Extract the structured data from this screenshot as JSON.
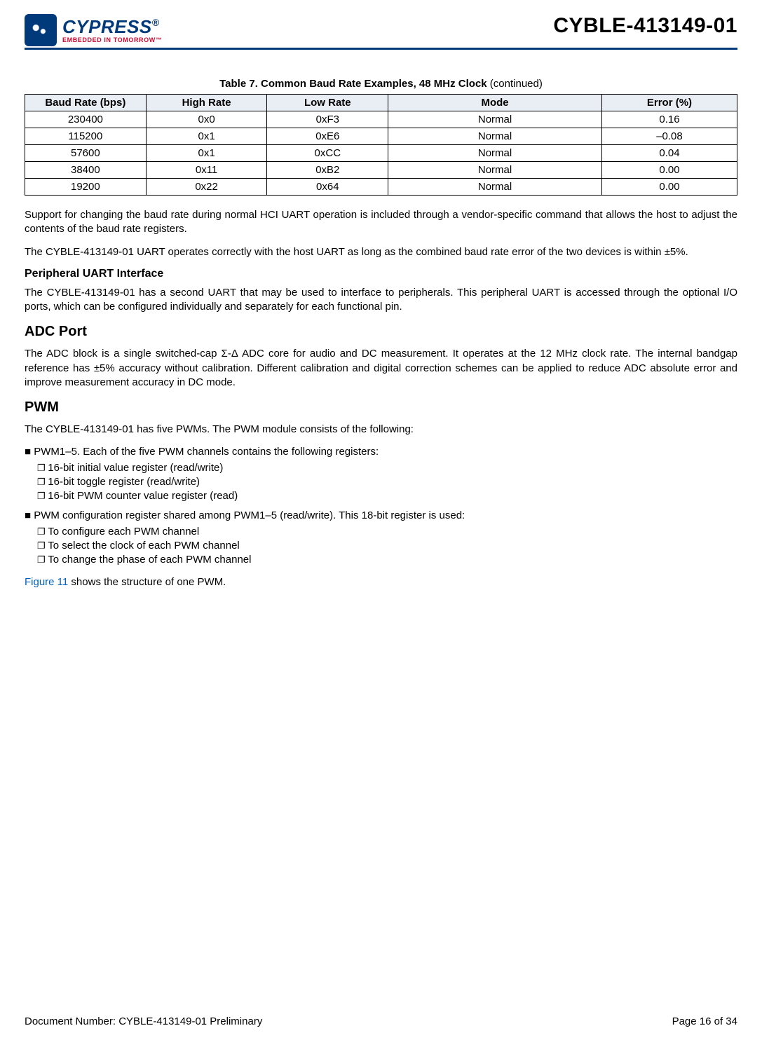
{
  "header": {
    "logo_name": "CYPRESS",
    "logo_reg": "®",
    "logo_tag": "EMBEDDED IN TOMORROW™",
    "doc_title": "CYBLE-413149-01"
  },
  "table": {
    "caption_prefix": "Table 7.  ",
    "caption_title": "Common Baud Rate Examples, 48 MHz Clock",
    "caption_suffix": " (continued)",
    "headers": [
      "Baud Rate (bps)",
      "High Rate",
      "Low Rate",
      "Mode",
      "Error (%)"
    ],
    "rows": [
      [
        "230400",
        "0x0",
        "0xF3",
        "Normal",
        "0.16"
      ],
      [
        "115200",
        "0x1",
        "0xE6",
        "Normal",
        "–0.08"
      ],
      [
        "57600",
        "0x1",
        "0xCC",
        "Normal",
        "0.04"
      ],
      [
        "38400",
        "0x11",
        "0xB2",
        "Normal",
        "0.00"
      ],
      [
        "19200",
        "0x22",
        "0x64",
        "Normal",
        "0.00"
      ]
    ]
  },
  "para1": "Support for changing the baud rate during normal HCI UART operation is included through a vendor-specific command that allows the host to adjust the contents of the baud rate registers.",
  "para2": "The CYBLE-413149-01 UART operates correctly with the host UART as long as the combined baud rate error of the two devices is within ±5%.",
  "sec_puart_h": "Peripheral UART Interface",
  "sec_puart_p": "The CYBLE-413149-01 has a second UART that may be used to interface to peripherals. This peripheral UART is accessed through the optional I/O ports, which can be configured individually and separately for each functional pin.",
  "sec_adc_h": "ADC Port",
  "sec_adc_p": "The ADC block is a single switched-cap Σ-Δ ADC core for audio and DC measurement. It operates at the 12 MHz clock rate. The internal bandgap reference has ±5% accuracy without calibration. Different calibration and digital correction schemes can be applied to reduce ADC absolute error and improve measurement accuracy in DC mode.",
  "sec_pwm_h": "PWM",
  "sec_pwm_intro": "The CYBLE-413149-01 has five PWMs. The PWM module consists of the following:",
  "pwm_item1": "PWM1–5. Each of the five PWM channels contains the following registers:",
  "pwm_item1_sub": [
    "16-bit initial value register (read/write)",
    "16-bit toggle register (read/write)",
    "16-bit PWM counter value register (read)"
  ],
  "pwm_item2": "PWM configuration register shared among PWM1–5 (read/write). This 18-bit register is used:",
  "pwm_item2_sub": [
    "To configure each PWM channel",
    "To select the clock of each PWM channel",
    "To change the phase of each PWM channel"
  ],
  "fig_ref_link": "Figure 11",
  "fig_ref_rest": " shows the structure of one PWM.",
  "footer": {
    "left": "Document Number:  CYBLE-413149-01 Preliminary",
    "right": "Page 16 of 34"
  }
}
